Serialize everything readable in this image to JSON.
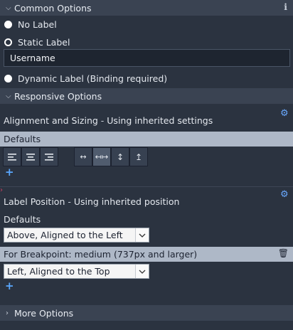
{
  "common": {
    "header": "Common Options",
    "info_icon": "info-icon",
    "options": [
      "No Label",
      "Static Label",
      "Dynamic Label (Binding required)"
    ],
    "selected_index": 1,
    "label_value": "Username"
  },
  "responsive": {
    "header": "Responsive Options",
    "alignment": {
      "title": "Alignment and Sizing",
      "subtitle": "Using inherited settings",
      "defaults_label": "Defaults",
      "align_buttons": [
        "align-left-icon",
        "align-center-icon",
        "align-right-icon"
      ],
      "size_buttons": [
        "fit-width-icon",
        "stretch-width-icon",
        "fit-height-icon",
        "stretch-height-icon"
      ]
    },
    "label_position": {
      "title": "Label Position",
      "subtitle": "Using inherited position",
      "defaults_label": "Defaults",
      "defaults_value": "Above, Aligned to the Left",
      "breakpoint_label": "For Breakpoint: medium (737px and larger)",
      "breakpoint_value": "Left, Aligned to the Top"
    }
  },
  "more": {
    "header": "More Options"
  },
  "colors": {
    "accent": "#6aa9ff",
    "band": "#aeb8c7",
    "panel": "#2b3340",
    "header": "#3a4352"
  }
}
